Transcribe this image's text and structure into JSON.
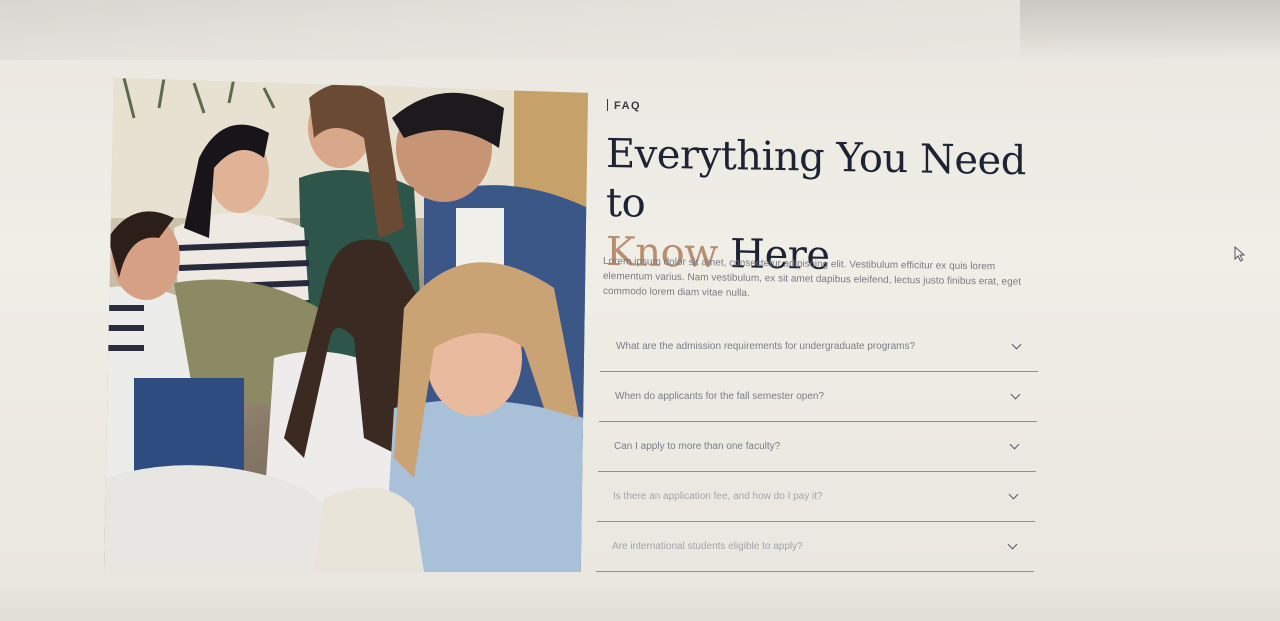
{
  "faq": {
    "eyebrow": "FAQ",
    "headline_line1": "Everything You Need to",
    "headline_accent": "Know",
    "headline_rest": " Here",
    "intro": "Lorem ipsum dolor sit amet, consectetur adipiscing elit. Vestibulum efficitur ex quis lorem elementum varius. Nam vestibulum, ex sit amet dapibus eleifend, lectus justo finibus erat, eget commodo lorem diam vitae nulla.",
    "questions": [
      "What are the admission requirements for undergraduate programs?",
      "When do applicants for the fall semester open?",
      "Can I apply to more than one faculty?",
      "Is there an application fee, and how do I pay it?",
      "Are international students eligible to apply?"
    ]
  },
  "icons": {
    "accordion": "chevron-down-icon",
    "cursor": "mouse-pointer-icon"
  },
  "colors": {
    "heading": "#1e2333",
    "accent": "#b98e6f",
    "body_text": "#7a7c84",
    "divider": "#8f9099"
  }
}
